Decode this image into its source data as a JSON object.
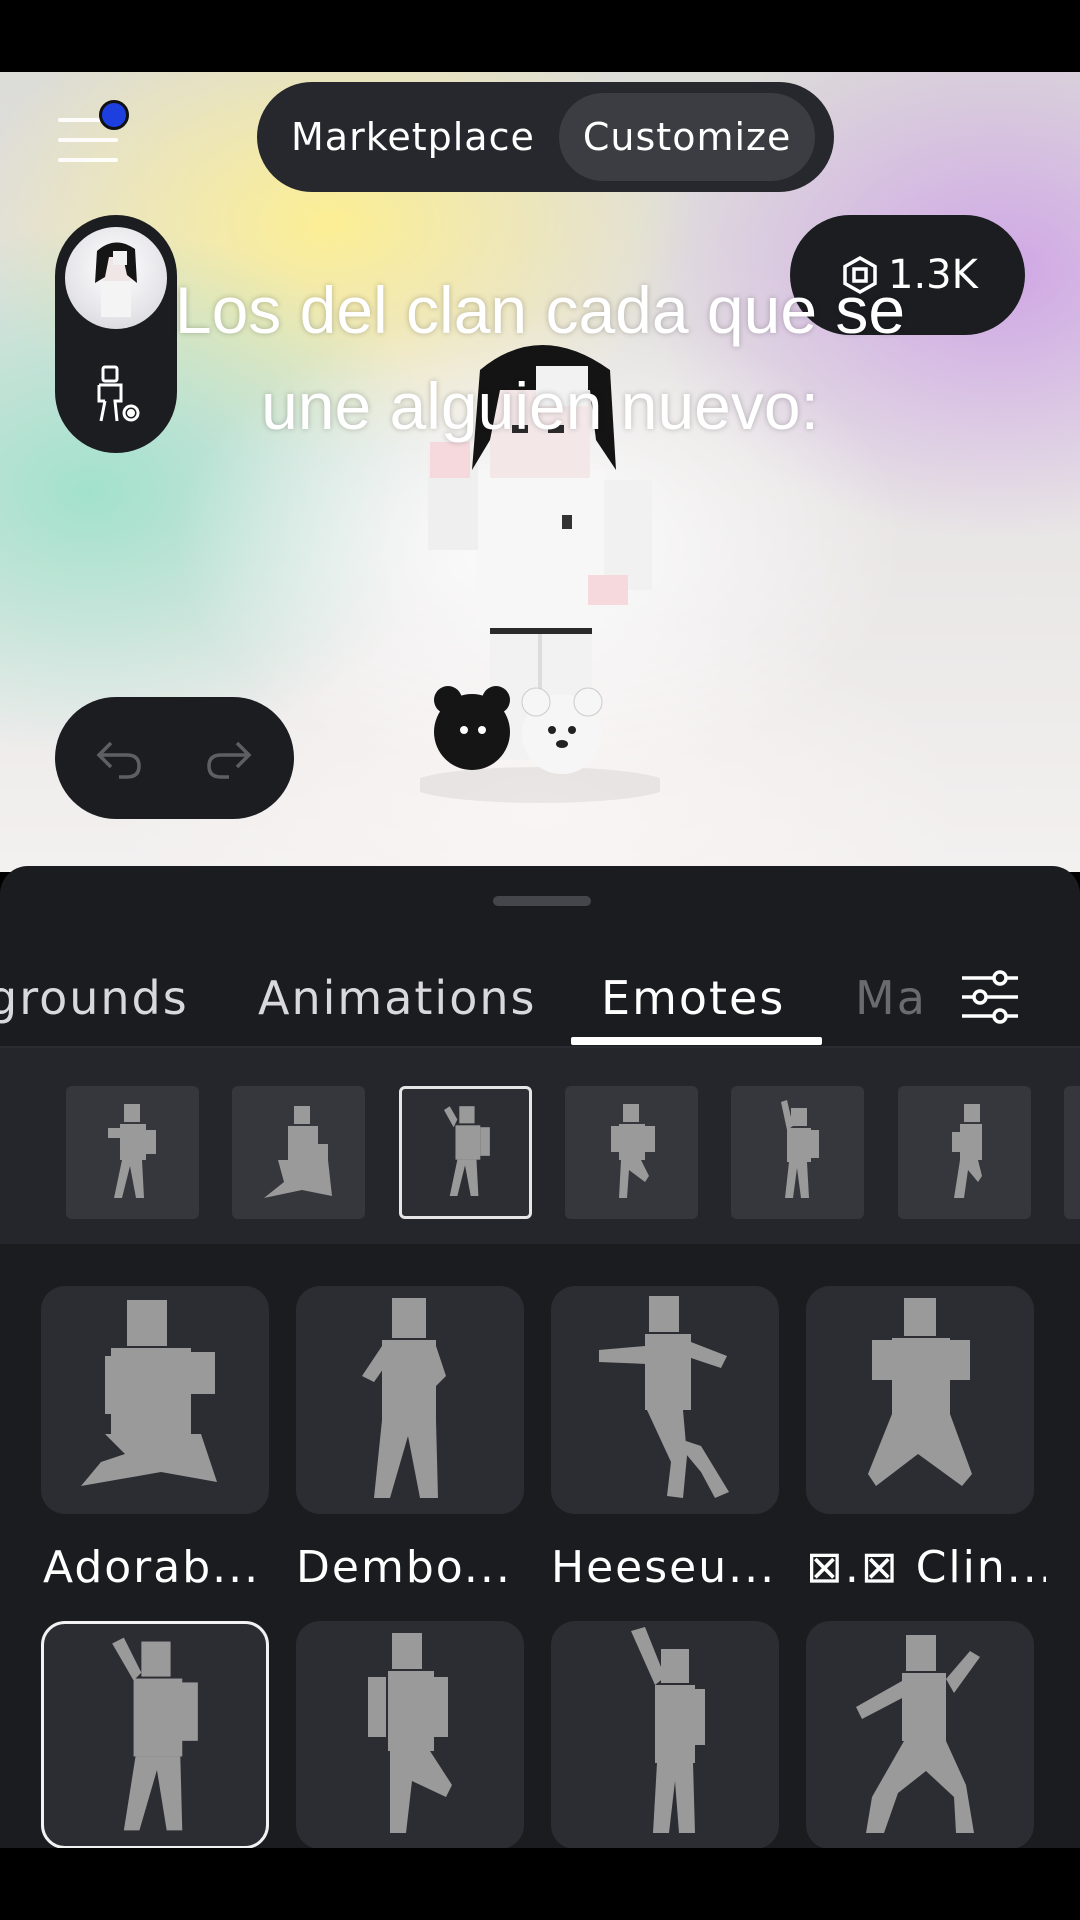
{
  "header": {
    "toggle": {
      "marketplace_label": "Marketplace",
      "customize_label": "Customize",
      "active": "Customize"
    },
    "currency": {
      "icon": "robux-icon",
      "amount": "1.3K"
    },
    "notification": {
      "icon": "menu-icon",
      "has_dot": true
    }
  },
  "caption": {
    "line1": "Los del clan cada que se",
    "line2": "une alguien nuevo:"
  },
  "history": {
    "undo_icon": "undo-icon",
    "redo_icon": "redo-icon"
  },
  "tabs": {
    "items": [
      {
        "label": "grounds"
      },
      {
        "label": "Animations"
      },
      {
        "label": "Emotes"
      },
      {
        "label": "Ma"
      }
    ],
    "active": "Emotes",
    "filter_icon": "sliders-icon"
  },
  "equipped_strip": {
    "slots": 6,
    "selected_index": 2
  },
  "emotes": [
    {
      "label": "Adorab..."
    },
    {
      "label": "Dembo..."
    },
    {
      "label": "Heeseu..."
    },
    {
      "label": "⊠.⊠ Clin..."
    },
    {
      "label": ""
    },
    {
      "label": ""
    },
    {
      "label": ""
    },
    {
      "label": ""
    }
  ],
  "colors": {
    "sheet_bg": "#1b1c20",
    "accent_dot": "#1e3fe0",
    "tile_bg": "#2c2d32"
  }
}
